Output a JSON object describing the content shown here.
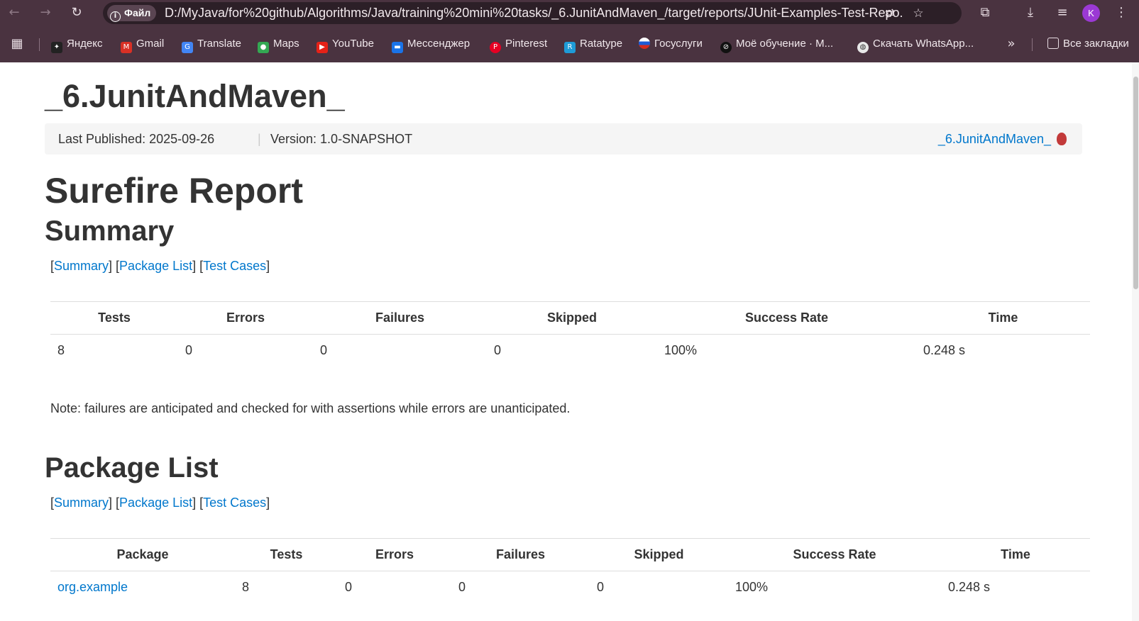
{
  "browser": {
    "chip_label": "Файл",
    "url": "D:/MyJava/for%20github/Algorithms/Java/training%20mini%20tasks/_6.JunitAndMaven_/target/reports/JUnit-Examples-Test-Repo...",
    "avatar_letter": "K",
    "bookmarks": [
      "Яндекс",
      "Gmail",
      "Translate",
      "Maps",
      "YouTube",
      "Мессенджер",
      "Pinterest",
      "Ratatype",
      "Госуслуги",
      "Моё обучение · M...",
      "Скачать WhatsApp..."
    ],
    "all_bookmarks_label": "Все закладки"
  },
  "page": {
    "project_title": "_6.JunitAndMaven_",
    "last_published": "Last Published: 2025-09-26",
    "breadcrumb_sep": "|",
    "version": "Version: 1.0-SNAPSHOT",
    "project_link": "_6.JunitAndMaven_",
    "report_title": "Surefire Report",
    "summary_heading": "Summary",
    "package_list_heading": "Package List",
    "nav": {
      "summary": "Summary",
      "package_list": "Package List",
      "test_cases": "Test Cases"
    },
    "summary_table": {
      "headers": [
        "Tests",
        "Errors",
        "Failures",
        "Skipped",
        "Success Rate",
        "Time"
      ],
      "row": [
        "8",
        "0",
        "0",
        "0",
        "100%",
        "0.248 s"
      ]
    },
    "note": "Note: failures are anticipated and checked for with assertions while errors are unanticipated.",
    "package_table": {
      "headers": [
        "Package",
        "Tests",
        "Errors",
        "Failures",
        "Skipped",
        "Success Rate",
        "Time"
      ],
      "row": [
        "org.example",
        "8",
        "0",
        "0",
        "0",
        "100%",
        "0.248 s"
      ]
    }
  }
}
